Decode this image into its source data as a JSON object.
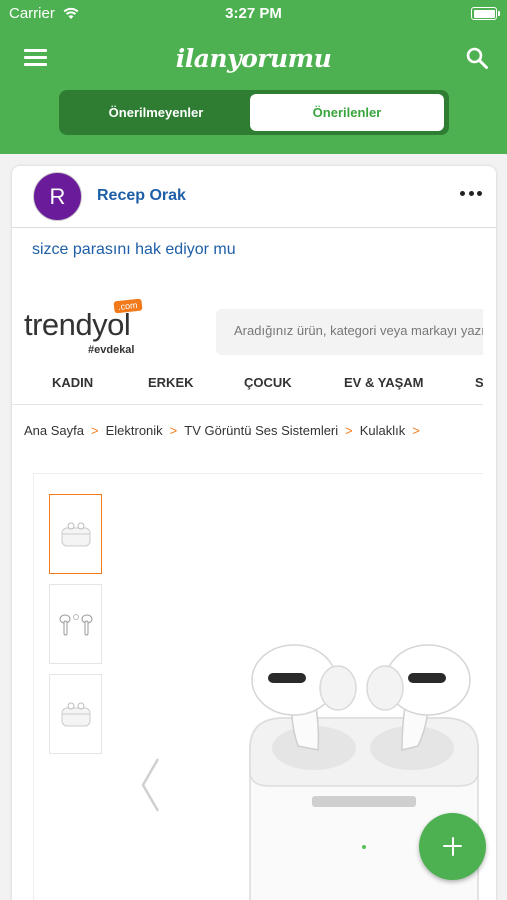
{
  "status_bar": {
    "carrier": "Carrier",
    "time": "3:27 PM"
  },
  "header": {
    "logo": "ilanyorumu"
  },
  "segment": {
    "left": "Önerilmeyenler",
    "right": "Önerilenler",
    "selected": "Önerilenler"
  },
  "post": {
    "avatar_letter": "R",
    "username": "Recep Orak",
    "text": "sizce parasını hak ediyor mu"
  },
  "screenshot": {
    "logo": "trendyol",
    "logo_badge": ".com",
    "slogan": "#evdekal",
    "search_placeholder": "Aradığınız ürün, kategori veya markayı yazın",
    "nav": [
      "KADIN",
      "ERKEK",
      "ÇOCUK",
      "EV & YAŞAM",
      "S"
    ],
    "breadcrumbs": [
      "Ana Sayfa",
      "Elektronik",
      "TV Görüntü Ses Sistemleri",
      "Kulaklık"
    ]
  },
  "colors": {
    "primary_green": "#4db151",
    "dark_green": "#2e7d32",
    "link_blue": "#1e5fa7",
    "avatar_purple": "#6a1b9a",
    "trendyol_orange": "#f27a1a"
  },
  "icons": [
    "wifi-icon",
    "battery-icon",
    "hamburger-menu-icon",
    "search-icon",
    "more-options-icon",
    "chevron-right-icon",
    "chevron-left-icon",
    "plus-icon"
  ]
}
